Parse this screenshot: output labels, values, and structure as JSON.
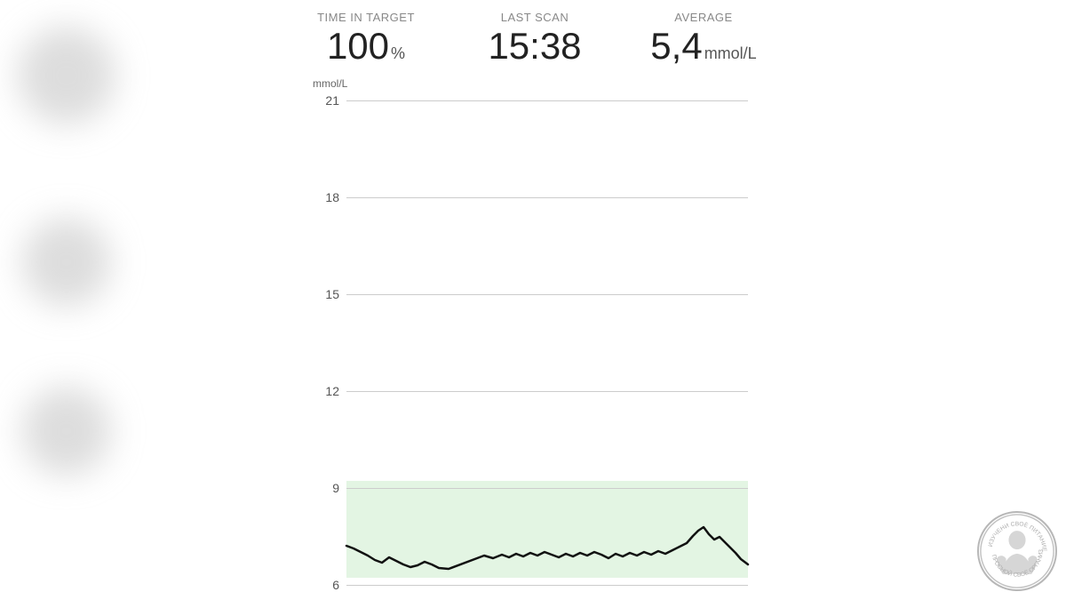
{
  "stats": {
    "time_in_target": {
      "label": "TIME IN TARGET",
      "value": "100",
      "unit": "%"
    },
    "last_scan": {
      "label": "LAST SCAN",
      "value": "15:38",
      "unit": ""
    },
    "average": {
      "label": "AVERAGE",
      "value": "5,4",
      "unit": "mmol/L"
    }
  },
  "chart": {
    "y_axis_unit": "mmol/L",
    "grid_lines": [
      21,
      18,
      15,
      12,
      9,
      6
    ],
    "target_min": 6,
    "target_max": 9
  },
  "watermark": {
    "line1": "ИЗУЧЕНИ СВОЁ ПИТАНИЕ",
    "line2": "ПРОСНОЙ СВОЁ ОРГАНИЗМ"
  }
}
